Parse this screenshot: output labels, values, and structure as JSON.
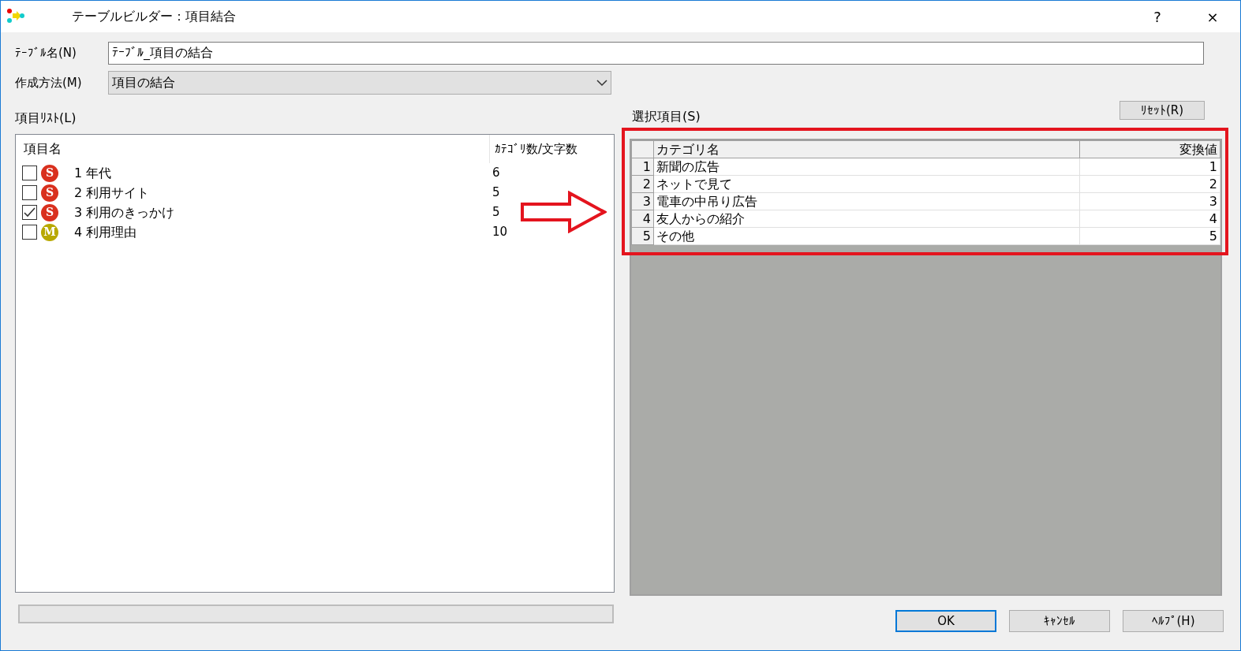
{
  "window": {
    "title": "テーブルビルダー：項目結合",
    "help_button": "?",
    "close_button": "×"
  },
  "table_name": {
    "label": "ﾃｰﾌﾞﾙ名(N)",
    "value": "ﾃｰﾌﾞﾙ_項目の結合"
  },
  "method": {
    "label": "作成方法(M)",
    "value": "項目の結合"
  },
  "item_list": {
    "label": "項目ﾘｽﾄ(L)",
    "columns": [
      "項目名",
      "ｶﾃｺﾞﾘ数/文字数"
    ],
    "rows": [
      {
        "checked": false,
        "kind": "single",
        "badge": "S",
        "name": "1 年代",
        "count": "6"
      },
      {
        "checked": false,
        "kind": "single",
        "badge": "S",
        "name": "2 利用サイト",
        "count": "5"
      },
      {
        "checked": true,
        "kind": "single",
        "badge": "S",
        "name": "3 利用のきっかけ",
        "count": "5"
      },
      {
        "checked": false,
        "kind": "multi",
        "badge": "M",
        "name": "4 利用理由",
        "count": "10"
      }
    ]
  },
  "selected_items": {
    "label": "選択項目(S)",
    "reset_button": "ﾘｾｯﾄ(R)",
    "columns": [
      "カテゴリ名",
      "変換値"
    ],
    "rows": [
      {
        "index": "1",
        "category": "新聞の広告",
        "value": "1"
      },
      {
        "index": "2",
        "category": "ネットで見て",
        "value": "2"
      },
      {
        "index": "3",
        "category": "電車の中吊り広告",
        "value": "3"
      },
      {
        "index": "4",
        "category": "友人からの紹介",
        "value": "4"
      },
      {
        "index": "5",
        "category": "その他",
        "value": "5"
      }
    ]
  },
  "buttons": [
    "OK",
    "ｷｬﾝｾﾙ",
    "ﾍﾙﾌﾟ(H)"
  ]
}
